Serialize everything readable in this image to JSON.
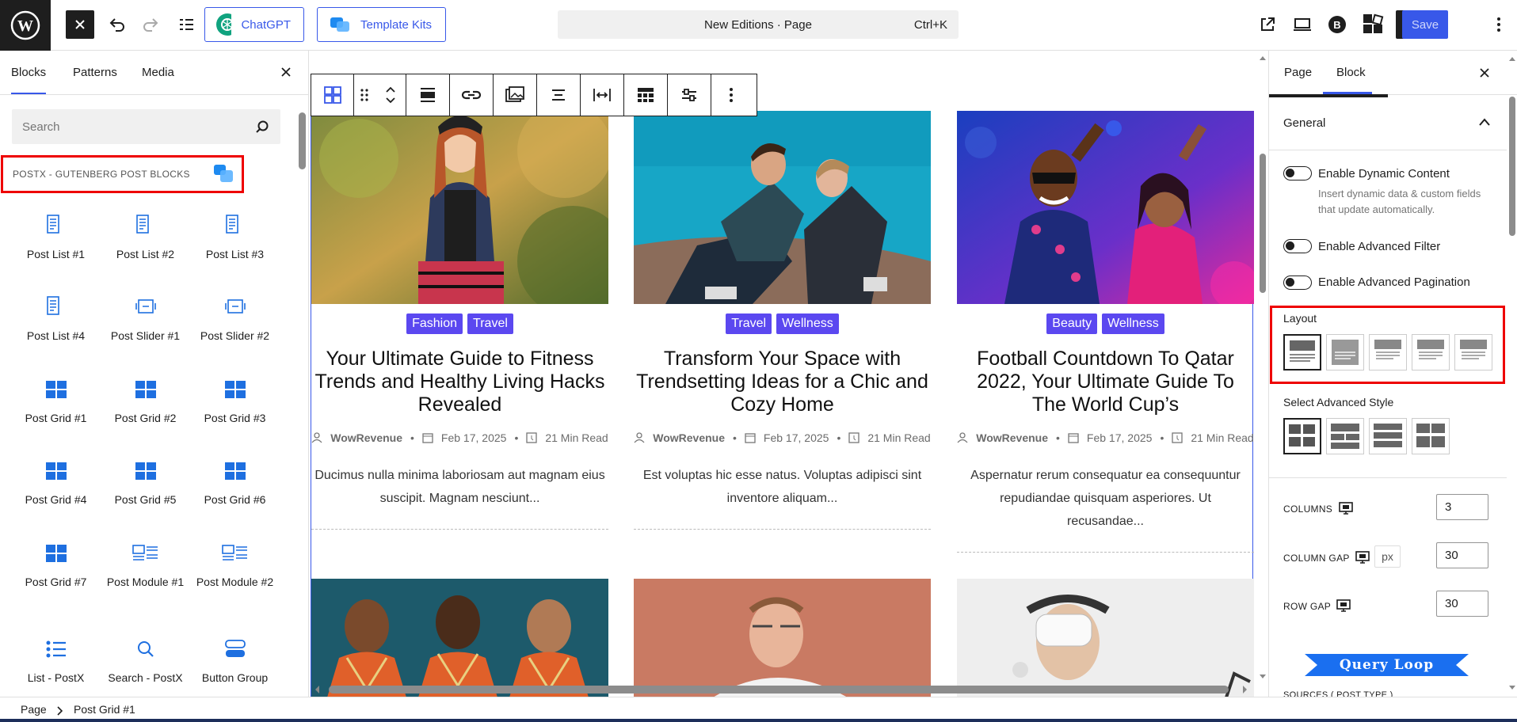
{
  "topbar": {
    "chatgpt_label": "ChatGPT",
    "template_kits_label": "Template Kits",
    "command_title": "New Editions · Page",
    "command_shortcut": "Ctrl+K",
    "save_label": "Save"
  },
  "left_panel": {
    "tabs": [
      "Blocks",
      "Patterns",
      "Media"
    ],
    "search_placeholder": "Search",
    "category_label": "POSTX - GUTENBERG POST BLOCKS",
    "blocks": [
      "Post List #1",
      "Post List #2",
      "Post List #3",
      "Post List #4",
      "Post Slider #1",
      "Post Slider #2",
      "Post Grid #1",
      "Post Grid #2",
      "Post Grid #3",
      "Post Grid #4",
      "Post Grid #5",
      "Post Grid #6",
      "Post Grid #7",
      "Post Module #1",
      "Post Module #2",
      "List - PostX",
      "Search - PostX",
      "Button Group"
    ]
  },
  "posts": [
    {
      "tags": [
        "Fashion",
        "Travel"
      ],
      "title": "Your Ultimate Guide to Fitness Trends and Healthy Living Hacks Revealed",
      "author": "WowRevenue",
      "date": "Feb 17, 2025",
      "read": "21 Min Read",
      "excerpt": "Ducimus nulla minima laboriosam aut magnam eius suscipit. Magnam nesciunt..."
    },
    {
      "tags": [
        "Travel",
        "Wellness"
      ],
      "title": "Transform Your Space with Trendsetting Ideas for a Chic and Cozy Home",
      "author": "WowRevenue",
      "date": "Feb 17, 2025",
      "read": "21 Min Read",
      "excerpt": "Est voluptas hic esse natus. Voluptas adipisci sint inventore aliquam..."
    },
    {
      "tags": [
        "Beauty",
        "Wellness"
      ],
      "title": "Football Countdown To Qatar 2022, Your Ultimate Guide To The World Cup’s",
      "author": "WowRevenue",
      "date": "Feb 17, 2025",
      "read": "21 Min Read",
      "excerpt": "Aspernatur rerum consequatur ea consequuntur repudiandae quisquam asperiores. Ut recusandae..."
    }
  ],
  "right_panel": {
    "tabs": [
      "Page",
      "Block"
    ],
    "section_title": "General",
    "dynamic_label": "Enable Dynamic Content",
    "dynamic_help": "Insert dynamic data & custom fields that update automatically.",
    "filter_label": "Enable Advanced Filter",
    "pagination_label": "Enable Advanced Pagination",
    "layout_label": "Layout",
    "advanced_style_label": "Select Advanced Style",
    "columns_label": "COLUMNS",
    "columns_value": "3",
    "column_gap_label": "COLUMN GAP",
    "column_gap_unit": "px",
    "column_gap_value": "30",
    "row_gap_label": "ROW GAP",
    "row_gap_value": "30",
    "ribbon_label": "Query Loop",
    "sources_label": "SOURCES ( POST TYPE )"
  },
  "breadcrumb": [
    "Page",
    "Post Grid #1"
  ],
  "colors": {
    "accent": "#3858e9",
    "tag_bg": "#5b48f0",
    "highlight_border": "#ee0000",
    "ribbon": "#1a6ff0"
  }
}
